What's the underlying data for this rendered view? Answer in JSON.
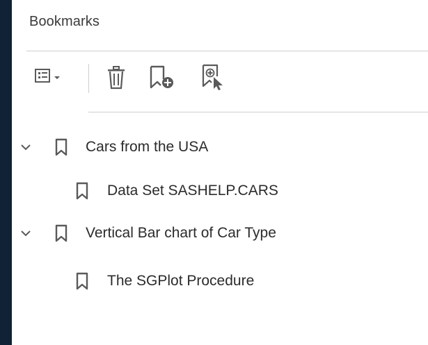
{
  "panel": {
    "title": "Bookmarks"
  },
  "toolbar": {
    "options_icon": "options-menu-icon",
    "delete_icon": "trash-icon",
    "add_icon": "add-bookmark-icon",
    "new_from_selection_icon": "bookmark-from-selection-icon"
  },
  "bookmarks": [
    {
      "label": "Cars from the USA",
      "expanded": true,
      "children": [
        {
          "label": "Data Set SASHELP.CARS"
        }
      ]
    },
    {
      "label": "Vertical Bar chart of Car Type",
      "expanded": true,
      "children": [
        {
          "label": "The SGPlot Procedure"
        }
      ]
    }
  ],
  "colors": {
    "frame": "#0f2236",
    "panel": "#ffffff",
    "icon": "#5a5a5a",
    "text": "#2b2b2b"
  }
}
